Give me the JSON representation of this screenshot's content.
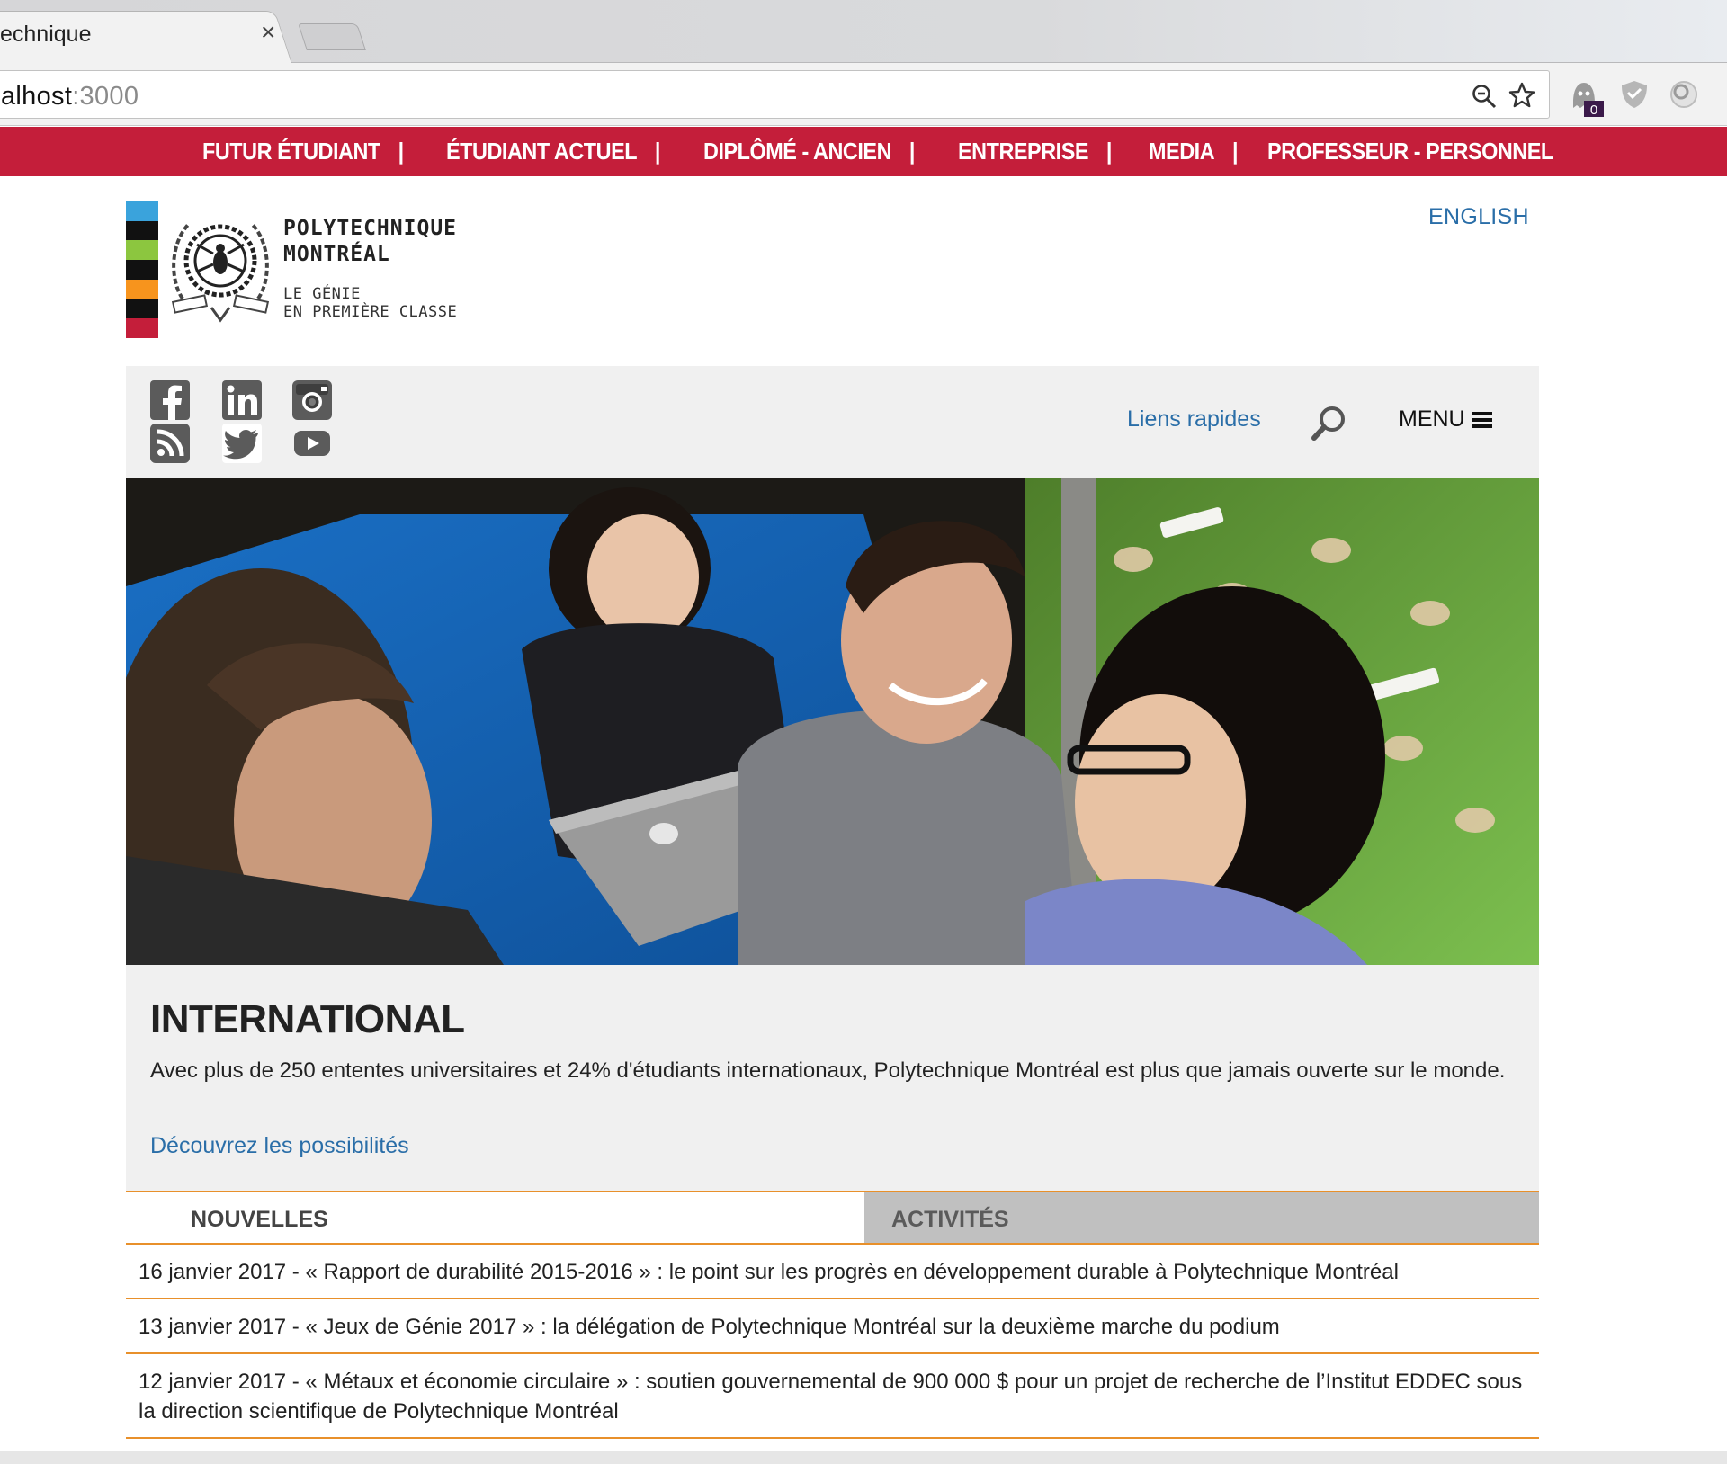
{
  "browser": {
    "tab_title": "echnique",
    "url_host": "alhost",
    "url_port": ":3000",
    "extension_badge": "0"
  },
  "topnav": {
    "items": [
      "FUTUR ÉTUDIANT",
      "ÉTUDIANT ACTUEL",
      "DIPLÔMÉ - ANCIEN",
      "ENTREPRISE",
      "MEDIA",
      "PROFESSEUR - PERSONNEL"
    ],
    "separator": "|"
  },
  "header": {
    "logo_line1": "POLYTECHNIQUE",
    "logo_line2": "MONTRÉAL",
    "tagline1": "LE GÉNIE",
    "tagline2": "EN PREMIÈRE CLASSE",
    "language_link": "ENGLISH",
    "logo_stripe_colors": [
      "#3aa3dc",
      "#111111",
      "#8cc63f",
      "#111111",
      "#f7941d",
      "#111111",
      "#c41e3a"
    ]
  },
  "utilbar": {
    "social_icons": [
      "facebook-icon",
      "linkedin-icon",
      "instagram-icon",
      "rss-icon",
      "twitter-icon",
      "youtube-icon"
    ],
    "quick_links": "Liens rapides",
    "menu_label": "MENU"
  },
  "feature": {
    "title": "INTERNATIONAL",
    "text": "Avec plus de 250 ententes universitaires et 24% d'étudiants internationaux, Polytechnique Montréal est plus que jamais ouverte sur le monde.",
    "link": "Découvrez les possibilités"
  },
  "tabs": {
    "news": "NOUVELLES",
    "activities": "ACTIVITÉS"
  },
  "news": [
    "16 janvier 2017 - « Rapport de durabilité 2015-2016 » : le point sur les progrès en développement durable à Polytechnique Montréal",
    "13 janvier 2017 - « Jeux de Génie 2017 » : la délégation de Polytechnique Montréal sur la deuxième marche du podium",
    "12 janvier 2017 - « Métaux et économie circulaire » : soutien gouvernemental de 900 000 $ pour un projet de recherche de l’Institut EDDEC sous la direction scientifique de Polytechnique Montréal"
  ],
  "colors": {
    "brand_red": "#c41e3a",
    "link_blue": "#2a6ea8",
    "accent_orange": "#e8902b"
  }
}
